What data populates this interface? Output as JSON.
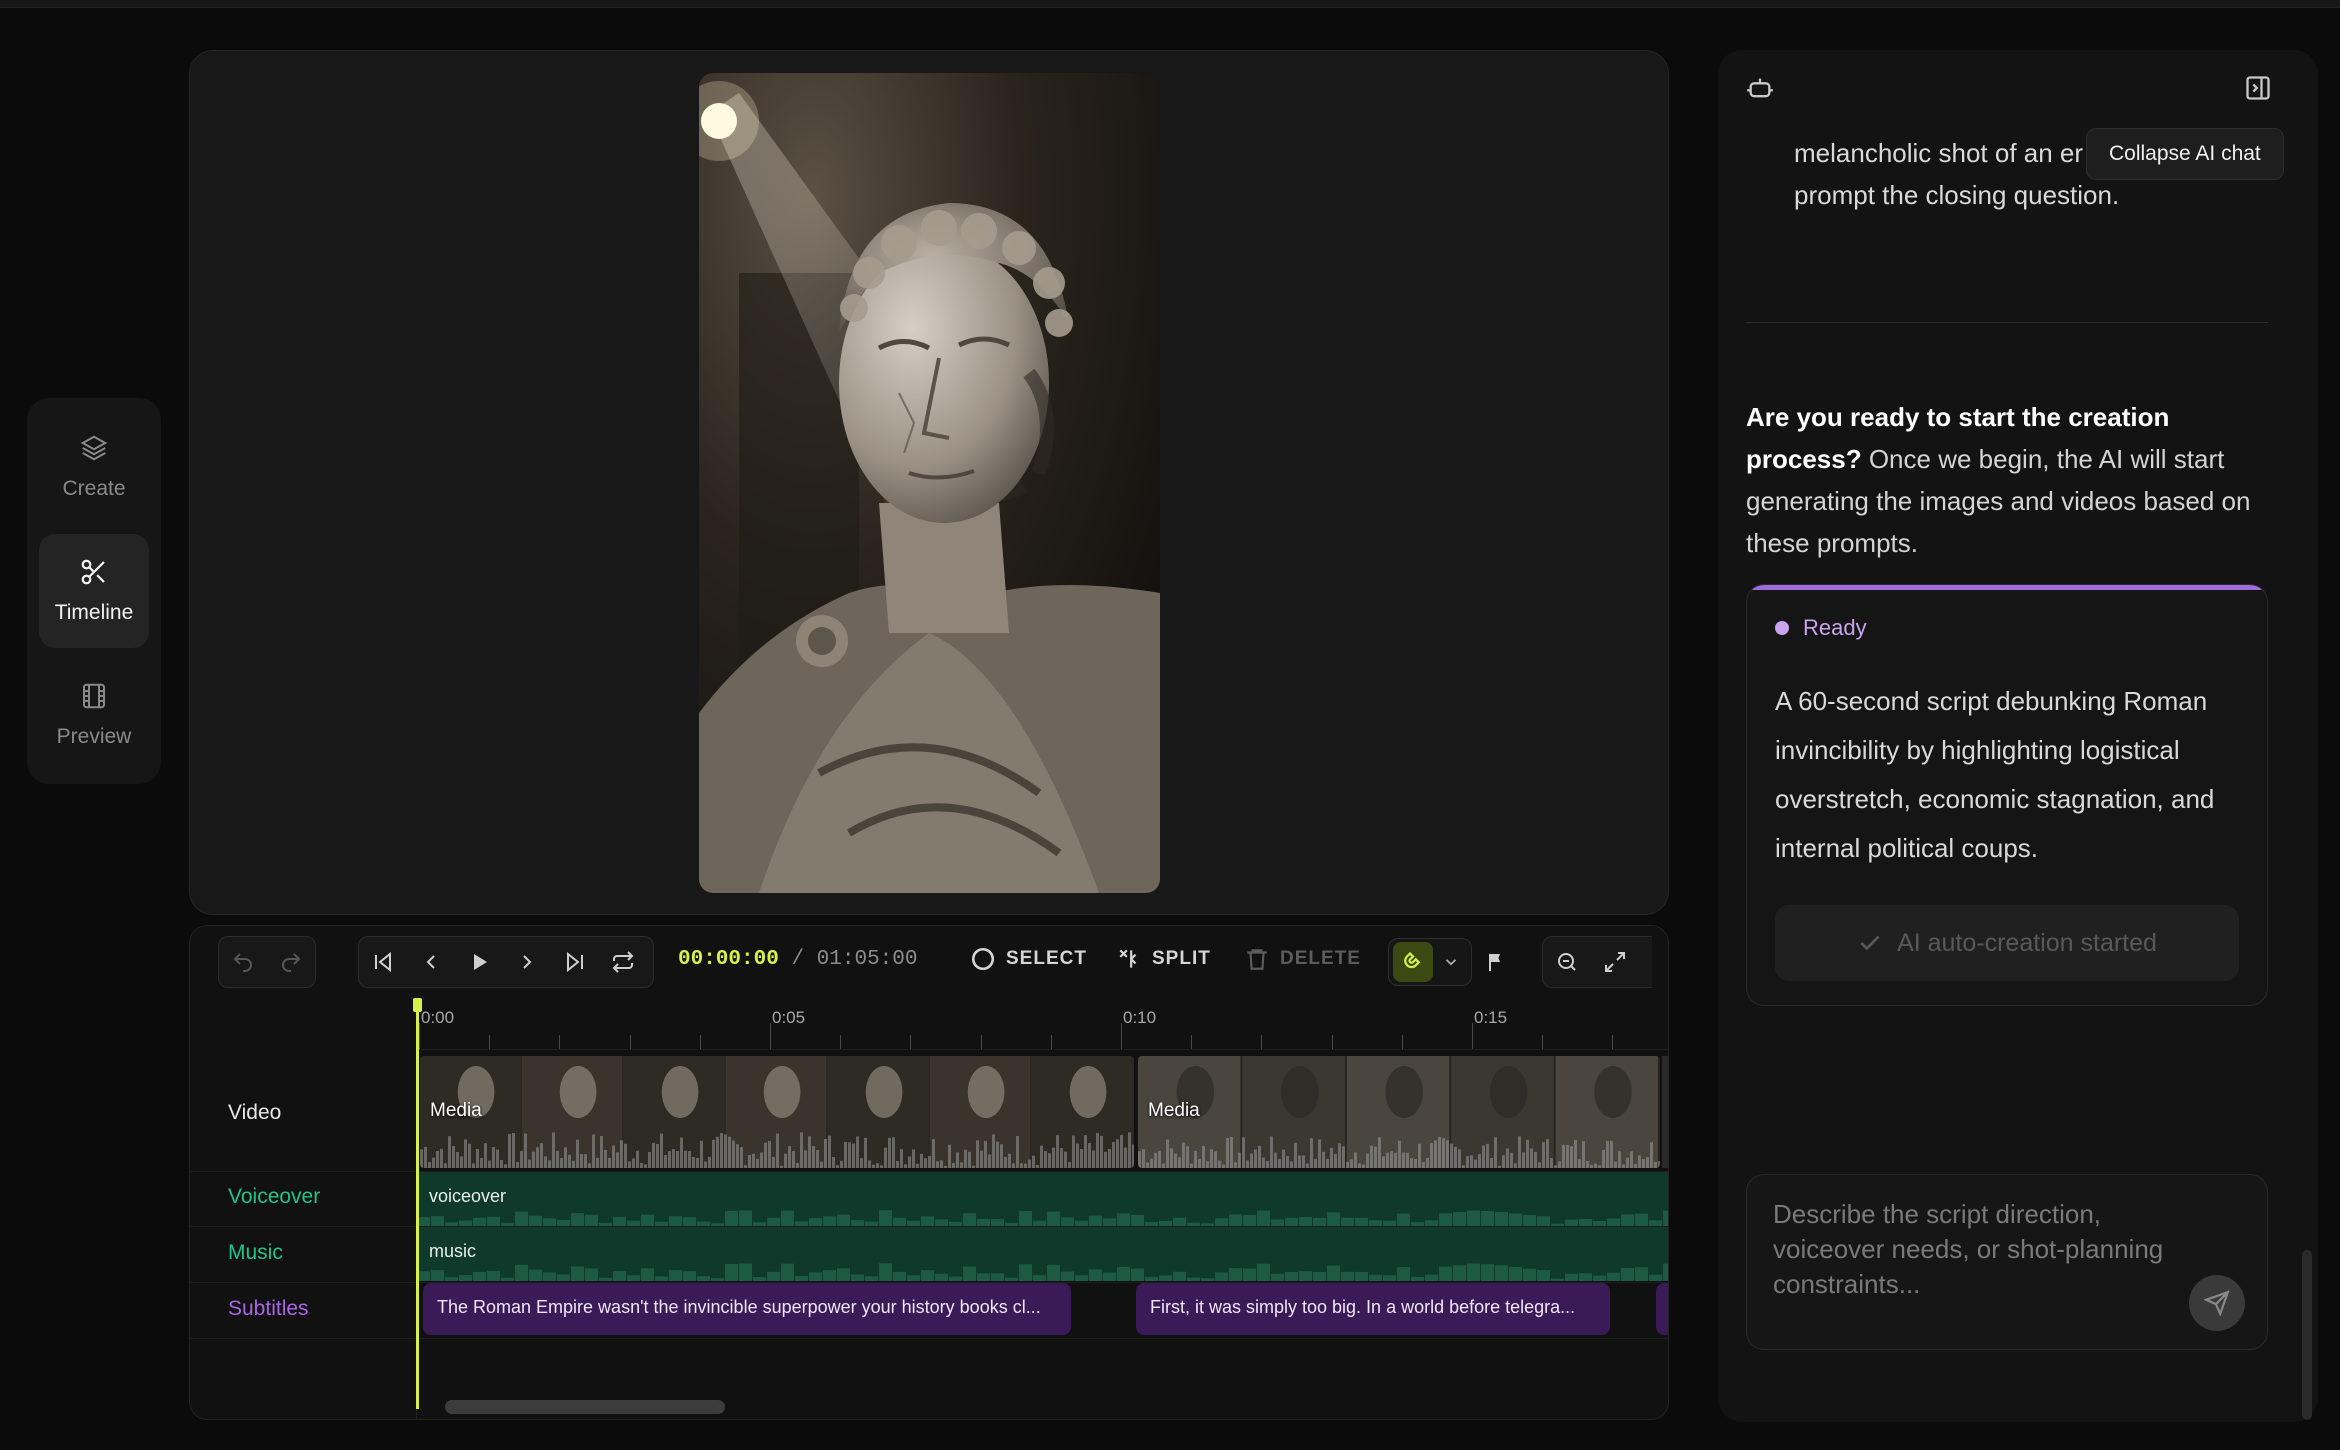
{
  "nav": {
    "items": [
      {
        "label": "Create",
        "icon": "layers-icon",
        "active": false
      },
      {
        "label": "Timeline",
        "icon": "scissors-icon",
        "active": true
      },
      {
        "label": "Preview",
        "icon": "film-icon",
        "active": false
      }
    ]
  },
  "preview": {
    "image_description_icon": "statue-portrait-image"
  },
  "timeline": {
    "current_time": "00:00:00",
    "separator": "/",
    "total_time": "01:05:00",
    "select_label": "SELECT",
    "split_label": "SPLIT",
    "delete_label": "DELETE",
    "ruler_labels": [
      "0:00",
      "0:05",
      "0:10",
      "0:15"
    ],
    "track_labels": {
      "video": "Video",
      "voiceover": "Voiceover",
      "music": "Music",
      "subtitles": "Subtitles"
    },
    "video_clips": [
      "Media",
      "Media"
    ],
    "voiceover_clip": "voiceover",
    "music_clip": "music",
    "subtitle_clips": [
      "The Roman Empire wasn't the invincible superpower your history books cl...",
      "First, it was simply too big. In a world before telegra..."
    ],
    "colors": {
      "accent": "#d8f04a",
      "voiceover": "#22c38a",
      "subtitles": "#a865e6"
    }
  },
  "chat": {
    "tooltip": "Collapse AI chat",
    "previous_message": "melancholic shot of an er throne room to prompt the closing question.",
    "question_bold": "Are you ready to start the creation process?",
    "question_rest": " Once we begin, the AI will start generating the images and videos based on these prompts.",
    "card": {
      "status": "Ready",
      "text": "A 60-second script debunking Roman invincibility by highlighting logistical overstretch, economic stagnation, and internal political coups.",
      "button": "AI auto-creation started"
    },
    "input_placeholder": "Describe the script direction, voiceover needs, or shot-planning constraints..."
  }
}
